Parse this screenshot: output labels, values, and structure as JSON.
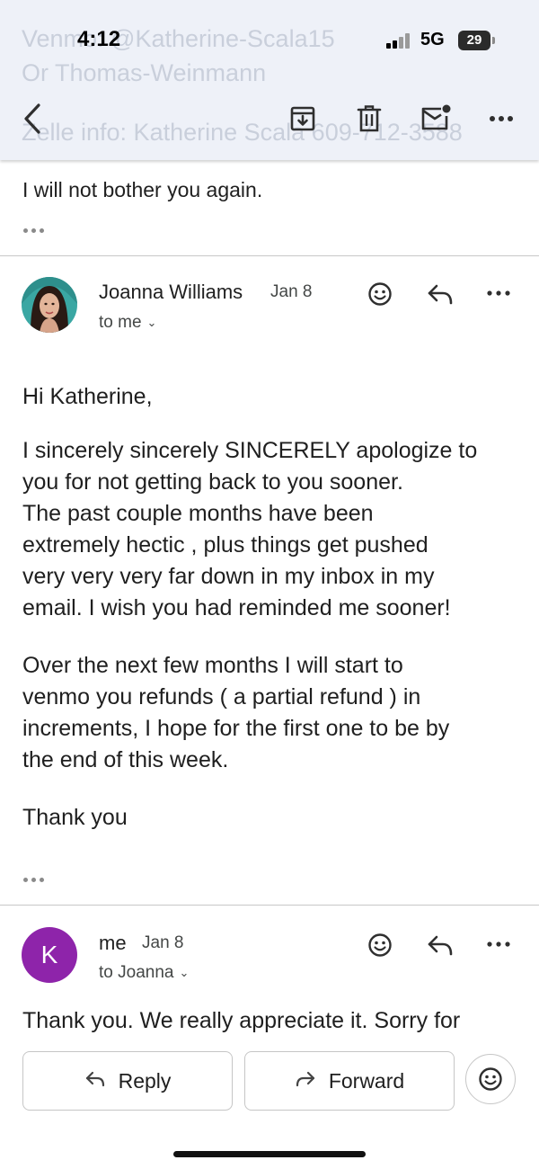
{
  "status_bar": {
    "time": "4:12",
    "network": "5G",
    "battery": "29"
  },
  "background_ghost": {
    "line1": "Venmo: @Katherine-Scala15",
    "line2": "Or Thomas-Weinmann",
    "line3": "Zelle info: Katherine Scala 609-712-3588"
  },
  "toolbar": {
    "back_icon": "back-arrow",
    "archive_icon": "archive",
    "delete_icon": "trash",
    "mark_unread_icon": "mail-unread",
    "more_icon": "more-horizontal"
  },
  "previous_message": {
    "snippet": "I will not bother you again."
  },
  "message1": {
    "sender": "Joanna Williams",
    "date": "Jan 8",
    "recipient": "to me",
    "greeting": "Hi Katherine,",
    "paragraph1": "I sincerely sincerely SINCERELY apologize to\nyou for not getting back to you sooner.\nThe past couple months have been\nextremely hectic , plus things get pushed\nvery very very far down in my inbox in my\nemail. I wish you had reminded me sooner!",
    "paragraph2": "Over the next few months I will start to\nvenmo you refunds ( a partial refund ) in\nincrements,  I hope for the first one to be by\nthe end of this week.",
    "closing": "Thank you"
  },
  "message2": {
    "avatar_letter": "K",
    "sender": "me",
    "date": "Jan 8",
    "recipient": "to Joanna",
    "preview": "Thank you. We really appreciate it. Sorry for"
  },
  "actions": {
    "reply_label": "Reply",
    "forward_label": "Forward"
  },
  "colors": {
    "header_bg": "#eef1f8",
    "avatar_me": "#8e24aa",
    "divider": "#c8c8c8"
  }
}
